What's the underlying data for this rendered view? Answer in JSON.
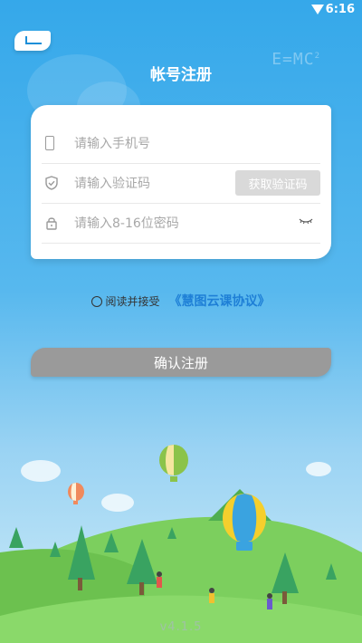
{
  "status": {
    "time": "6:16"
  },
  "header": {
    "title": "帐号注册",
    "decoration": "E=MC"
  },
  "form": {
    "phone_placeholder": "请输入手机号",
    "code_placeholder": "请输入验证码",
    "get_code_label": "获取验证码",
    "password_placeholder": "请输入8-16位密码"
  },
  "agreement": {
    "prefix": "阅读并接受",
    "link": "《慧图云课协议》"
  },
  "submit_label": "确认注册",
  "footer": {
    "version": "v4.1.5"
  },
  "colors": {
    "sky": "#35a8ea",
    "link": "#1e7fd6",
    "button": "#9a9a9a"
  }
}
